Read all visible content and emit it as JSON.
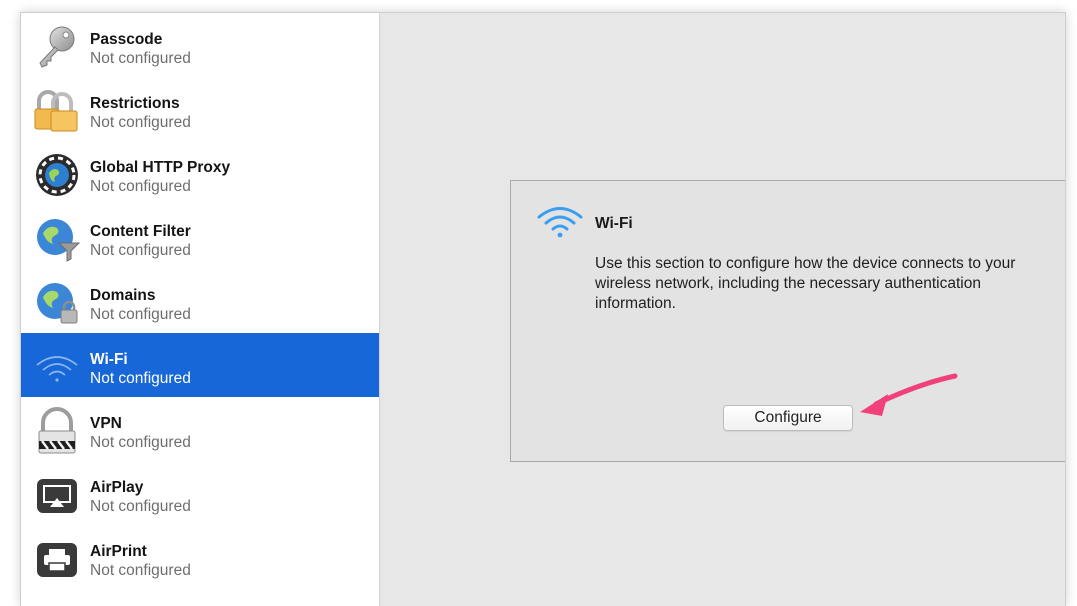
{
  "sidebar": {
    "items": [
      {
        "title": "Passcode",
        "subtitle": "Not configured",
        "icon": "key-icon"
      },
      {
        "title": "Restrictions",
        "subtitle": "Not configured",
        "icon": "padlocks-icon"
      },
      {
        "title": "Global HTTP Proxy",
        "subtitle": "Not configured",
        "icon": "globe-proxy-icon"
      },
      {
        "title": "Content Filter",
        "subtitle": "Not configured",
        "icon": "globe-filter-icon"
      },
      {
        "title": "Domains",
        "subtitle": "Not configured",
        "icon": "globe-lock-icon"
      },
      {
        "title": "Wi-Fi",
        "subtitle": "Not configured",
        "icon": "wifi-icon",
        "selected": true
      },
      {
        "title": "VPN",
        "subtitle": "Not configured",
        "icon": "vpn-lock-icon"
      },
      {
        "title": "AirPlay",
        "subtitle": "Not configured",
        "icon": "airplay-icon"
      },
      {
        "title": "AirPrint",
        "subtitle": "Not configured",
        "icon": "printer-icon"
      }
    ]
  },
  "detail": {
    "title": "Wi-Fi",
    "description": "Use this section to configure how the device connects to your wireless network, including the necessary authentication information.",
    "configure_label": "Configure",
    "icon": "wifi-icon"
  },
  "colors": {
    "selection": "#1767d8",
    "wifi_blue": "#3a9ef0",
    "arrow_pink": "#f0417a"
  }
}
